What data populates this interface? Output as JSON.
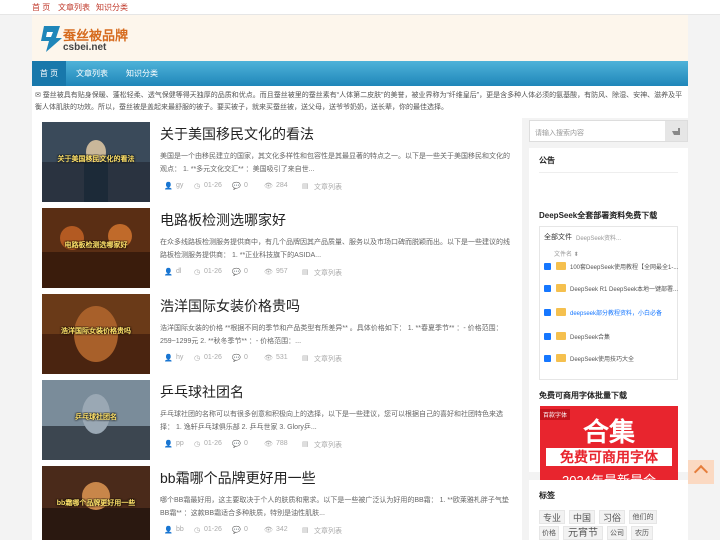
{
  "topbar": {
    "links": [
      "首 页",
      "文章列表",
      "知识分类"
    ]
  },
  "header": {
    "logo_title": "蚕丝被品牌",
    "logo_sub": "csbei.net"
  },
  "nav": {
    "items": [
      "首 页",
      "文章列表",
      "知识分类"
    ]
  },
  "notice": {
    "text": "✉ 蚕丝被具有贴身保暖、蓬松轻柔、透气保健等得天独厚的品质和优点。而且蚕丝被里的蚕丝素有“人体第二皮肤”的美誉，被业界称为“纤维皇后”，更是含多种人体必须的氨基酸，有防风、除湿、安神、滋养及平衡人体肌肤的功效。所以，蚕丝被是盖起来最舒服的被子。要买被子，就来买蚕丝被，送父母，送爷爷奶奶，送长辈，你的最佳选择。"
  },
  "posts": [
    {
      "title": "关于美国移民文化的看法",
      "thumb_caption": "关于美国移民文化的看法",
      "excerpt": "美国是一个由移民建立的国家，其文化多样性和包容性是其最显著的特点之一。以下是一些关于美国移民和文化的观点： 1. **多元文化交汇** ：美国吸引了来自世...",
      "author": "gy",
      "date": "01-26",
      "comments": "0",
      "views": "284",
      "category": "文章列表"
    },
    {
      "title": "电路板检测选哪家好",
      "thumb_caption": "电路板检测选哪家好",
      "excerpt": "在众多线路板检测服务提供商中，有几个品牌因其产品质量、服务以及市场口碑而脱颖而出。以下是一些建议的线路板检测服务提供商： 1. **正业科技旗下的ASIDA...",
      "author": "dl",
      "date": "01-26",
      "comments": "0",
      "views": "957",
      "category": "文章列表"
    },
    {
      "title": "浩洋国际女装价格贵吗",
      "thumb_caption": "浩洋国际女装价格贵吗",
      "excerpt": "浩洋国际女装的价格 **根据不同的季节和产品类型有所差异** 。具体价格如下： 1. **春夏季节** ：- 价格范围：259~1299元 2. **秋冬季节** ：- 价格范围：...",
      "author": "hy",
      "date": "01-26",
      "comments": "0",
      "views": "531",
      "category": "文章列表"
    },
    {
      "title": "乒乓球社团名",
      "thumb_caption": "乒乓球社团名",
      "excerpt": "乒乓球社团的名称可以有很多创意和积极向上的选择，以下是一些建议，您可以根据自己的喜好和社团特色来选择： 1. 逸轩乒乓球俱乐部 2. 乒乓世家 3. Glory乒...",
      "author": "pp",
      "date": "01-26",
      "comments": "0",
      "views": "788",
      "category": "文章列表"
    },
    {
      "title": "bb霜哪个品牌更好用一些",
      "thumb_caption": "bb霜哪个品牌更好用一些",
      "excerpt": "哪个BB霜最好用，这主要取决于个人的肤质和需求。以下是一些被广泛认为好用的BB霜： 1. **欧莱雅札胖子气垫BB霜** ：这款BB霜适合多种肤质，特别是油性肌肤...",
      "author": "bb",
      "date": "01-26",
      "comments": "0",
      "views": "342",
      "category": "文章列表"
    }
  ],
  "sidebar": {
    "search_placeholder": "请输入搜索内容",
    "notice_title": "公告",
    "download_title": "DeepSeek全套部署资料免费下载",
    "download_box": {
      "header": "全部文件",
      "crumb": "DeepSeek资料...",
      "column": "文件名 ⬍",
      "files": [
        "100套DeepSeek使用教程【全网最全1-...",
        "DeepSeek R1 DeepSeek本地一键部署...",
        "deepseek部分教程资料，小白必备",
        "DeepSeek合集",
        "DeepSeek使用技巧大全"
      ],
      "accent": "#1677ff",
      "folder_color": "#f5c04e"
    },
    "font_title": "免费可商用字体批量下载",
    "font_banner": {
      "tag": "百款字体",
      "big": "合集",
      "mid": "免费可商用字体",
      "low": "2024年最新最全",
      "color": "#e8252e"
    },
    "tags_title": "标签",
    "tags": [
      "专业",
      "中国",
      "习俗",
      "他们的",
      "价格",
      "元宵节",
      "公司",
      "农历"
    ]
  },
  "colors": {
    "nav_gradient_top": "#4fb3d9",
    "nav_gradient_bottom": "#1f86b9",
    "brand_orange": "#d66b1e",
    "link_red": "#c0392b"
  }
}
